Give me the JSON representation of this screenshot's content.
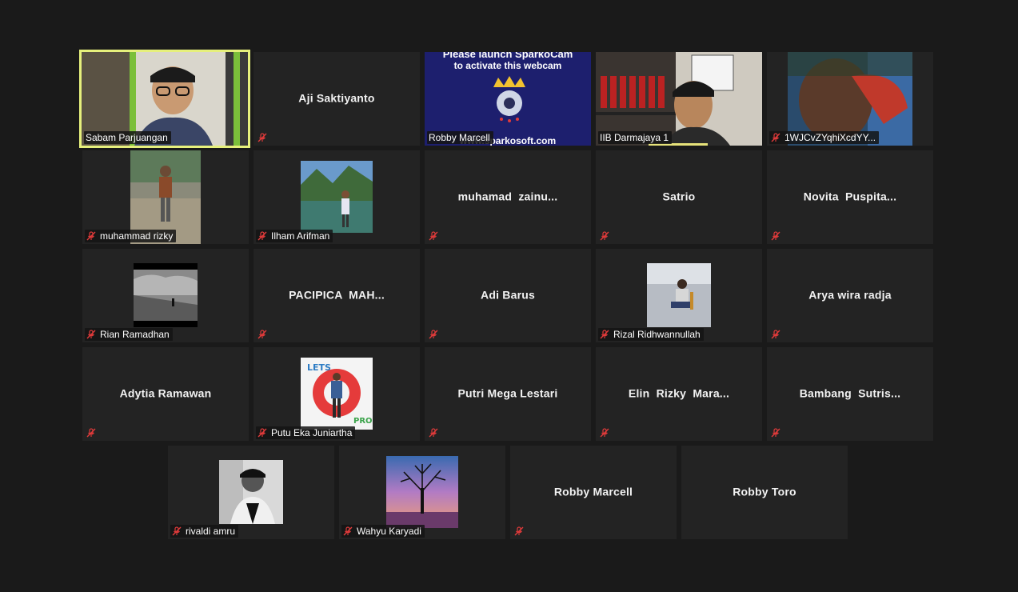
{
  "meeting": {
    "tiles": [
      {
        "name": "Sabam Parjuangan",
        "muted": false,
        "video": "cam-man-cap",
        "active": true
      },
      {
        "name": "Aji Saktiyanto",
        "muted": true,
        "display": "Aji Saktiyanto"
      },
      {
        "name": "Robby Marcell",
        "muted": false,
        "video": "sparkocam",
        "overlay": [
          "Please launch SparkoCam",
          "to activate this webcam",
          "www.sparkosoft.com"
        ]
      },
      {
        "name": "IIB Darmajaya 1",
        "muted": false,
        "video": "cam-office"
      },
      {
        "name": "1WJCvZYqhiXcdYY...",
        "muted": true,
        "video": "cam-closeup"
      },
      {
        "name": "muhammad rizky",
        "muted": true,
        "photo": "outdoor-man"
      },
      {
        "name": "Ilham Arifman",
        "muted": true,
        "photo": "lake-man"
      },
      {
        "name": "muhamad zainu...",
        "muted": true,
        "display": "muhamad  zainu..."
      },
      {
        "name": "Satrio",
        "muted": true,
        "display": "Satrio"
      },
      {
        "name": "Novita Puspita...",
        "muted": true,
        "display": "Novita  Puspita..."
      },
      {
        "name": "Rian Ramadhan",
        "muted": true,
        "photo": "bw-field"
      },
      {
        "name": "PACIPICA MAH...",
        "muted": true,
        "display": "PACIPICA  MAH..."
      },
      {
        "name": "Adi Barus",
        "muted": true,
        "display": "Adi Barus"
      },
      {
        "name": "Rizal Ridhwannullah",
        "muted": true,
        "photo": "sitting-man"
      },
      {
        "name": "Arya wira radja",
        "muted": true,
        "display": "Arya wira radja"
      },
      {
        "name": "Adytia Ramawan",
        "muted": true,
        "display": "Adytia Ramawan"
      },
      {
        "name": "Putu Eka Juniartha",
        "muted": true,
        "photo": "lets-pro"
      },
      {
        "name": "Putri Mega Lestari",
        "muted": true,
        "display": "Putri Mega Lestari"
      },
      {
        "name": "Elin Rizky Mara...",
        "muted": true,
        "display": "Elin  Rizky  Mara..."
      },
      {
        "name": "Bambang Sutris...",
        "muted": true,
        "display": "Bambang  Sutris..."
      },
      {
        "name": "rivaldi amru",
        "muted": true,
        "photo": "bw-portrait"
      },
      {
        "name": "Wahyu Karyadi",
        "muted": true,
        "photo": "tree"
      },
      {
        "name": "Robby Marcell",
        "muted": true,
        "display": "Robby Marcell"
      },
      {
        "name": "Robby Toro",
        "muted": false,
        "display": "Robby Toro"
      }
    ]
  },
  "colors": {
    "background": "#1a1a1a",
    "tile": "#232323",
    "active_speaker": "#e6f07c",
    "mute_red": "#e03a3a"
  }
}
